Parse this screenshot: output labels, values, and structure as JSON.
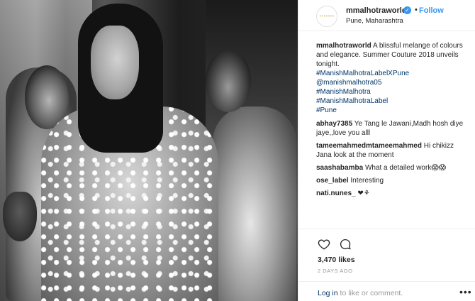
{
  "post": {
    "username": "mmalhotraworld",
    "follow_label": "Follow",
    "dot": "•",
    "location": "Pune, Maharashtra"
  },
  "caption": {
    "username": "mmalhotraworld",
    "text": "A blissful melange of colours and elegance. Summer Couture 2018 unveils tonight.",
    "hashtags": [
      "#ManishMalhotraLabelXPune",
      "@manishmalhotra05",
      "#ManishMalhotra",
      "#ManishMalhotraLabel",
      "#Pune"
    ]
  },
  "comments": [
    {
      "user": "abhay7385",
      "text": "Ye Tang le Jawani,Madh hosh diye jaye,,love you alll"
    },
    {
      "user": "tameemahmedmtameemahmed",
      "text": "Hi chikizz Jana look at the moment"
    },
    {
      "user": "saashabamba",
      "text": "What a detailed work😱😱"
    },
    {
      "user": "ose_label",
      "text": "Interesting"
    },
    {
      "user": "nati.nunes_",
      "text": "❤⚘"
    }
  ],
  "likes": "3,470 likes",
  "date": "2 DAYS AGO",
  "login": {
    "link_text": "Log in",
    "rest_text": " to like or comment."
  },
  "more_glyph": "•••",
  "icons": {
    "like": "heart-icon",
    "comment": "comment-icon",
    "verified": "verified-badge-icon",
    "more": "more-options-icon"
  },
  "colors": {
    "accent": "#3897f0",
    "link": "#003569",
    "muted": "#999999"
  }
}
